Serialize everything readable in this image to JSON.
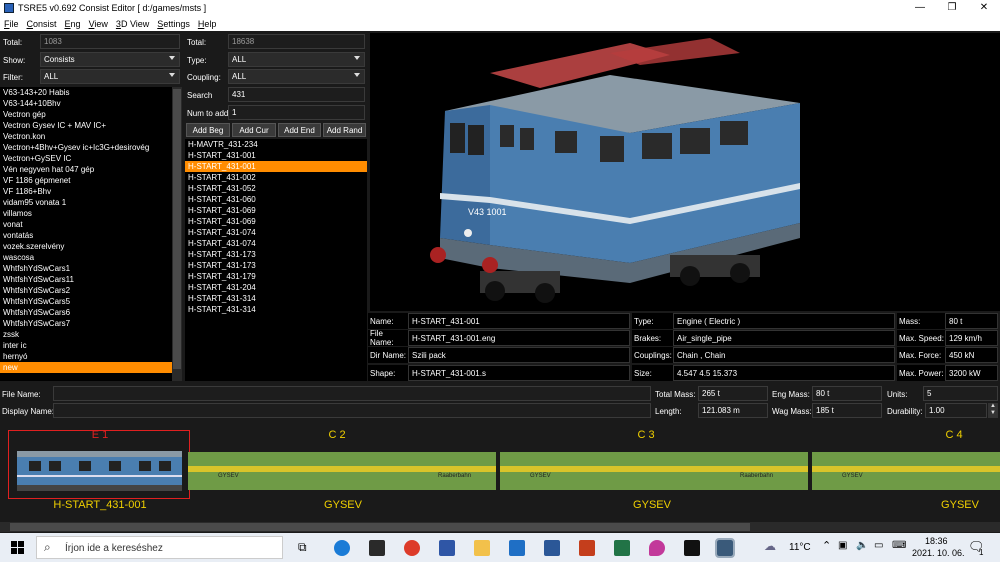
{
  "window": {
    "title": "TSRE5 v0.692 Consist Editor  [ d:/games/msts ]",
    "min": "—",
    "max": "❐",
    "close": "✕"
  },
  "menu": [
    "File",
    "Consist",
    "Eng",
    "View",
    "3D View",
    "Settings",
    "Help"
  ],
  "left": {
    "total_label": "Total:",
    "total_value": "1083",
    "show_label": "Show:",
    "show_value": "Consists",
    "filter_label": "Filter:",
    "filter_value": "ALL",
    "items": [
      "V63-143+20 Habis",
      "V63-144+10Bhv",
      "Vectron gép",
      "Vectron Gysev IC + MAV IC+",
      "Vectron.kon",
      "Vectron+4Bhv+Gysev ic+Ic3G+desirovég",
      "Vectron+GySEV IC",
      "Vén negyven hat 047 gép",
      "VF 1186 gépmenet",
      "VF 1186+Bhv",
      "vidam95 vonata 1",
      "villamos",
      "vonat",
      "vontatás",
      "vozek.szerelvény",
      "wascosa",
      "WhtfshYdSwCars1",
      "WhtfshYdSwCars11",
      "WhtfshYdSwCars2",
      "WhtfshYdSwCars5",
      "WhtfshYdSwCars6",
      "WhtfshYdSwCars7",
      "zssk",
      "inter ic",
      "hernyó",
      "new"
    ],
    "selected": "new"
  },
  "mid": {
    "total_label": "Total:",
    "total_value": "18638",
    "type_label": "Type:",
    "type_value": "ALL",
    "coupling_label": "Coupling:",
    "coupling_value": "ALL",
    "search_label": "Search",
    "search_value": "431",
    "num_label": "Num to add",
    "num_value": "1",
    "buttons": [
      "Add Beg",
      "Add Cur",
      "Add End",
      "Add Rand"
    ],
    "items": [
      "H-MAVTR_431-234",
      "H-START_431-001",
      "H-START_431-001",
      "H-START_431-002",
      "H-START_431-052",
      "H-START_431-060",
      "H-START_431-069",
      "H-START_431-069",
      "H-START_431-074",
      "H-START_431-074",
      "H-START_431-173",
      "H-START_431-173",
      "H-START_431-179",
      "H-START_431-204",
      "H-START_431-314",
      "H-START_431-314"
    ],
    "selected_index": 2
  },
  "preview": {
    "loco_number": "V43 1001"
  },
  "info": {
    "name_label": "Name:",
    "name_value": "H-START_431-001",
    "file_label": "File Name:",
    "file_value": "H-START_431-001.eng",
    "dir_label": "Dir Name:",
    "dir_value": "Szili pack",
    "shape_label": "Shape:",
    "shape_value": "H-START_431-001.s",
    "type_label": "Type:",
    "type_value": "Engine ( Electric )",
    "brakes_label": "Brakes:",
    "brakes_value": "Air_single_pipe",
    "couplings_label": "Couplings:",
    "couplings_value": "Chain , Chain",
    "size_label": "Size:",
    "size_value": "4.547 4.5 15.373",
    "mass_label": "Mass:",
    "mass_value": "80 t",
    "speed_label": "Max. Speed:",
    "speed_value": "129 km/h",
    "force_label": "Max. Force:",
    "force_value": "450 kN",
    "power_label": "Max. Power:",
    "power_value": "3200 kW"
  },
  "consist": {
    "file_label": "File Name:",
    "display_label": "Display Name:",
    "total_mass_label": "Total Mass:",
    "total_mass_value": "265 t",
    "eng_mass_label": "Eng Mass:",
    "eng_mass_value": "80 t",
    "units_label": "Units:",
    "units_value": "5",
    "length_label": "Length:",
    "length_value": "121.083 m",
    "wag_mass_label": "Wag Mass:",
    "wag_mass_value": "185 t",
    "durability_label": "Durability:",
    "durability_value": "1.00"
  },
  "cars": [
    {
      "no": "E 1",
      "name": "H-START_431-001"
    },
    {
      "no": "C 2",
      "name": "GYSEV"
    },
    {
      "no": "C 3",
      "name": "GYSEV"
    },
    {
      "no": "C 4",
      "name": "GYSEV"
    }
  ],
  "car_livery": {
    "gysev_left": "GYSEV",
    "gysev_right": "Raaberbahn"
  },
  "taskbar": {
    "search_placeholder": "Írjon ide a kereséshez",
    "weather": "11°C",
    "time": "18:36",
    "date": "2021. 10. 06.",
    "notif": "1"
  },
  "colors": {
    "accent": "#ff8c00",
    "car_label": "#f0d000",
    "selected_car": "#e02020"
  }
}
